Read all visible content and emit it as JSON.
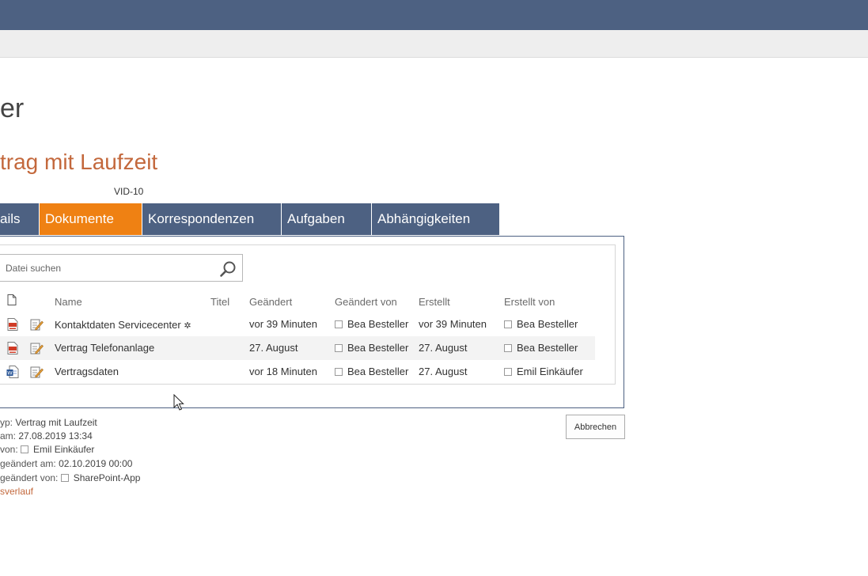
{
  "page": {
    "title": "er",
    "item_title": "trag mit Laufzeit",
    "item_id": "VID-10"
  },
  "tabs": [
    {
      "label": "ails",
      "active": false
    },
    {
      "label": "Dokumente",
      "active": true
    },
    {
      "label": "Korrespondenzen",
      "active": false
    },
    {
      "label": "Aufgaben",
      "active": false
    },
    {
      "label": "Abhängigkeiten",
      "active": false
    }
  ],
  "search": {
    "placeholder": "Datei suchen",
    "value": ""
  },
  "table": {
    "columns": {
      "name": "Name",
      "titel": "Titel",
      "geaendert": "Geändert",
      "geaendert_von": "Geändert von",
      "erstellt": "Erstellt",
      "erstellt_von": "Erstellt von"
    },
    "rows": [
      {
        "type": "pdf",
        "name": "Kontaktdaten Servicecenter",
        "new_marker": "✲",
        "titel": "",
        "geaendert": "vor 39 Minuten",
        "geaendert_von": "Bea Besteller",
        "erstellt": "vor 39 Minuten",
        "erstellt_von": "Bea Besteller"
      },
      {
        "type": "pdf",
        "name": "Vertrag Telefonanlage",
        "new_marker": "",
        "titel": "",
        "geaendert": "27. August",
        "geaendert_von": "Bea Besteller",
        "erstellt": "27. August",
        "erstellt_von": "Bea Besteller"
      },
      {
        "type": "word",
        "name": "Vertragsdaten",
        "new_marker": "",
        "titel": "",
        "geaendert": "vor 18 Minuten",
        "geaendert_von": "Bea Besteller",
        "erstellt": "27. August",
        "erstellt_von": "Emil Einkäufer"
      }
    ]
  },
  "buttons": {
    "cancel": "Abbrechen"
  },
  "meta": {
    "type_label": "yp:",
    "type_value": "Vertrag mit Laufzeit",
    "created_label": "am:",
    "created_value": "27.08.2019 13:34",
    "created_by_label": "von:",
    "created_by_value": "Emil Einkäufer",
    "modified_label": "geändert am:",
    "modified_value": "02.10.2019 00:00",
    "modified_by_label": "geändert von:",
    "modified_by_value": "SharePoint-App",
    "history_link": "sverlauf"
  },
  "colors": {
    "nav": "#4d6182",
    "accent": "#ef8113",
    "title": "#c3683c"
  }
}
